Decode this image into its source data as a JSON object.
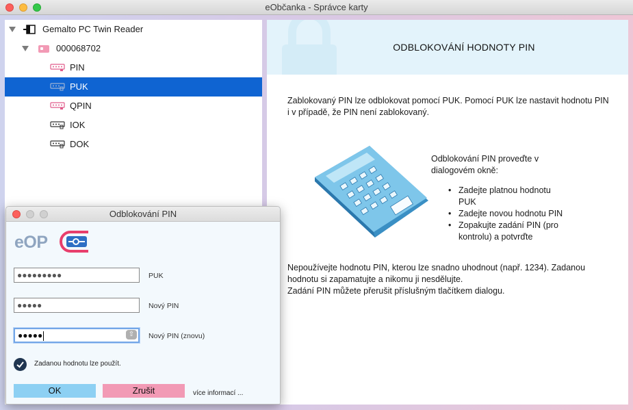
{
  "window": {
    "title": "eObčanka - Správce karty"
  },
  "tree": {
    "reader": "Gemalto PC Twin Reader",
    "card": "000068702",
    "items": [
      {
        "label": "PIN",
        "icon": "pin-pink-icon",
        "selected": false
      },
      {
        "label": "PUK",
        "icon": "key-gray-icon",
        "selected": true
      },
      {
        "label": "QPIN",
        "icon": "pin-pink-icon",
        "selected": false
      },
      {
        "label": "IOK",
        "icon": "key-gray-icon",
        "selected": false
      },
      {
        "label": "DOK",
        "icon": "key-gray-icon",
        "selected": false
      }
    ]
  },
  "info": {
    "title": "ODBLOKOVÁNÍ HODNOTY PIN",
    "intro_line1": "Zablokovaný PIN lze odblokovat pomocí PUK. Pomocí PUK lze nastavit hodnotu PIN",
    "intro_line2": "i v případě, že PIN není zablokovaný.",
    "steps_intro_line1": "Odblokování PIN proveďte v",
    "steps_intro_line2": "dialogovém okně:",
    "steps": [
      {
        "line1": "Zadejte platnou hodnotu",
        "line2": "PUK"
      },
      {
        "line1": "Zadejte novou hodnotu PIN",
        "line2": ""
      },
      {
        "line1": "Zopakujte zadání PIN (pro",
        "line2": "kontrolu) a potvrďte"
      }
    ],
    "warning_line1": "Nepoužívejte hodnotu PIN, kterou lze snadno uhodnout (např. 1234). Zadanou",
    "warning_line2": "hodnotu si zapamatujte a nikomu ji nesdělujte.",
    "warning_line3": "Zadání PIN můžete přerušit příslušným tlačítkem dialogu."
  },
  "dialog": {
    "title": "Odblokování PIN",
    "logo_text": "eOP",
    "puk_value": "●●●●●●●●●",
    "puk_label": "PUK",
    "new_pin_value": "●●●●●",
    "new_pin_label": "Nový PIN",
    "repeat_pin_value": "●●●●●",
    "repeat_pin_label": "Nový PIN (znovu)",
    "status_text": "Zadanou hodnotu lze použít.",
    "ok_label": "OK",
    "cancel_label": "Zrušit",
    "more_info_label": "více informací ..."
  },
  "colors": {
    "selection": "#0f64d2",
    "ok_button": "#8dd0f3",
    "cancel_button": "#f29ab5",
    "header_bg": "#e3f3fb"
  }
}
